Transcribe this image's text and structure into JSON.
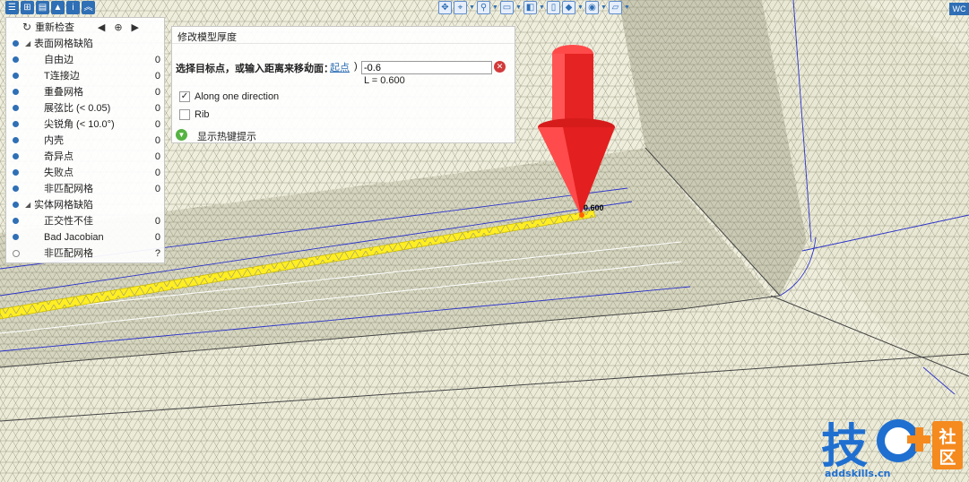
{
  "top_toolbar": {
    "wcs_label": "WC"
  },
  "check_panel": {
    "refresh_label": "重新检查",
    "groups": [
      {
        "label": "表面网格缺陷",
        "items": [
          {
            "label": "自由边",
            "count": "0"
          },
          {
            "label": "T连接边",
            "count": "0"
          },
          {
            "label": "重叠网格",
            "count": "0"
          },
          {
            "label": "展弦比 (< 0.05)",
            "count": "0"
          },
          {
            "label": "尖锐角 (< 10.0°)",
            "count": "0"
          },
          {
            "label": "内壳",
            "count": "0"
          },
          {
            "label": "奇异点",
            "count": "0"
          },
          {
            "label": "失败点",
            "count": "0"
          },
          {
            "label": "非匹配网格",
            "count": "0"
          }
        ]
      },
      {
        "label": "实体网格缺陷",
        "items": [
          {
            "label": "正交性不佳",
            "count": "0"
          },
          {
            "label": "Bad Jacobian",
            "count": "0"
          },
          {
            "label": "非匹配网格",
            "count": "?"
          }
        ]
      }
    ]
  },
  "dialog": {
    "title": "修改模型厚度",
    "prompt": "选择目标点，或输入距离来移动面：",
    "paren_open": "(",
    "start_point_link": "起点",
    "paren_close": ")",
    "distance_value": "-0.6",
    "length_readout": "L = 0.600",
    "along_one_direction": {
      "label": "Along one direction",
      "checked": true
    },
    "rib": {
      "label": "Rib",
      "checked": false
    },
    "show_hotkeys_label": "显示热键提示"
  },
  "viewport": {
    "dimension_label": "0.600"
  },
  "watermark": {
    "brand_char": "技",
    "community": [
      "社",
      "区"
    ],
    "url": "addskills.cn"
  },
  "colors": {
    "accent": "#2f6fb5",
    "arrow": "#e41e1e",
    "highlight": "#ffee22",
    "mesh_bg": "#efeedd"
  }
}
